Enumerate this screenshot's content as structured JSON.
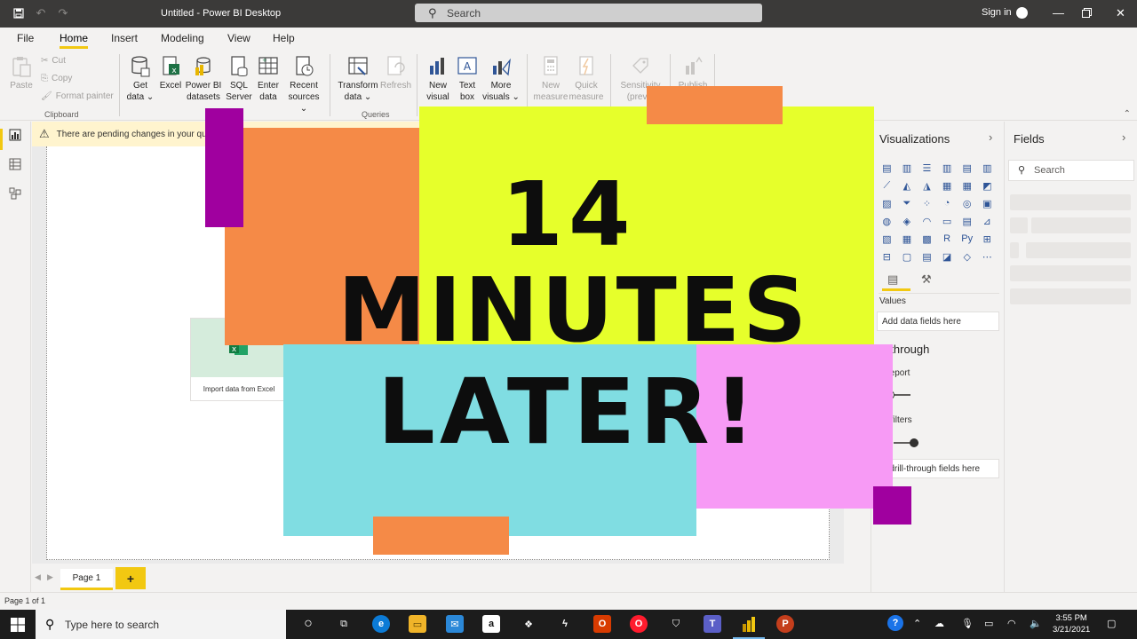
{
  "window": {
    "title": "Untitled - Power BI Desktop",
    "search_placeholder": "Search",
    "sign_in": "Sign in"
  },
  "ribbon_tabs": [
    "File",
    "Home",
    "Insert",
    "Modeling",
    "View",
    "Help"
  ],
  "ribbon": {
    "clipboard": {
      "paste": "Paste",
      "cut": "Cut",
      "copy": "Copy",
      "format_painter": "Format painter",
      "label": "Clipboard"
    },
    "data": {
      "get_data_1": "Get",
      "get_data_2": "data",
      "excel": "Excel",
      "pbi_1": "Power BI",
      "pbi_2": "datasets",
      "sql_1": "SQL",
      "sql_2": "Server",
      "enter_1": "Enter",
      "enter_2": "data",
      "recent_1": "Recent",
      "recent_2": "sources"
    },
    "queries": {
      "transform_1": "Transform",
      "transform_2": "data",
      "refresh": "Refresh",
      "label": "Queries"
    },
    "insert": {
      "new_visual_1": "New",
      "new_visual_2": "visual",
      "text_box_1": "Text",
      "text_box_2": "box",
      "more_visuals_1": "More",
      "more_visuals_2": "visuals"
    },
    "calc": {
      "new_measure_1": "New",
      "new_measure_2": "measure",
      "quick_measure_1": "Quick",
      "quick_measure_2": "measure"
    },
    "sensitivity_1": "Sensitivity",
    "sensitivity_2": "(previe",
    "publish": "Publish"
  },
  "banner": {
    "text": "There are pending changes in your qu"
  },
  "canvas": {
    "excel_card_label": "Import data from Excel"
  },
  "pages": {
    "tab": "Page 1",
    "add": "+"
  },
  "status": {
    "text": "Page 1 of 1"
  },
  "visualizations": {
    "title": "Visualizations",
    "values_label": "Values",
    "values_well": "Add data fields here",
    "drill_title": "ill through",
    "cross_report": "s-report",
    "off_label": "f",
    "keep_filters": "all filters",
    "on_label": "n",
    "drill_well": "d drill-through fields here"
  },
  "fields": {
    "title": "Fields",
    "search_placeholder": "Search"
  },
  "overlay": {
    "line1": "14",
    "line2": "MINUTES",
    "line3": "LATER!",
    "colors": {
      "orange": "#f58a47",
      "yellow": "#e6ff2b",
      "purple": "#a0009f",
      "cyan": "#80dde2",
      "pink": "#f79af5"
    }
  },
  "taskbar": {
    "search_placeholder": "Type here to search",
    "time": "3:55 PM",
    "date": "3/21/2021"
  }
}
